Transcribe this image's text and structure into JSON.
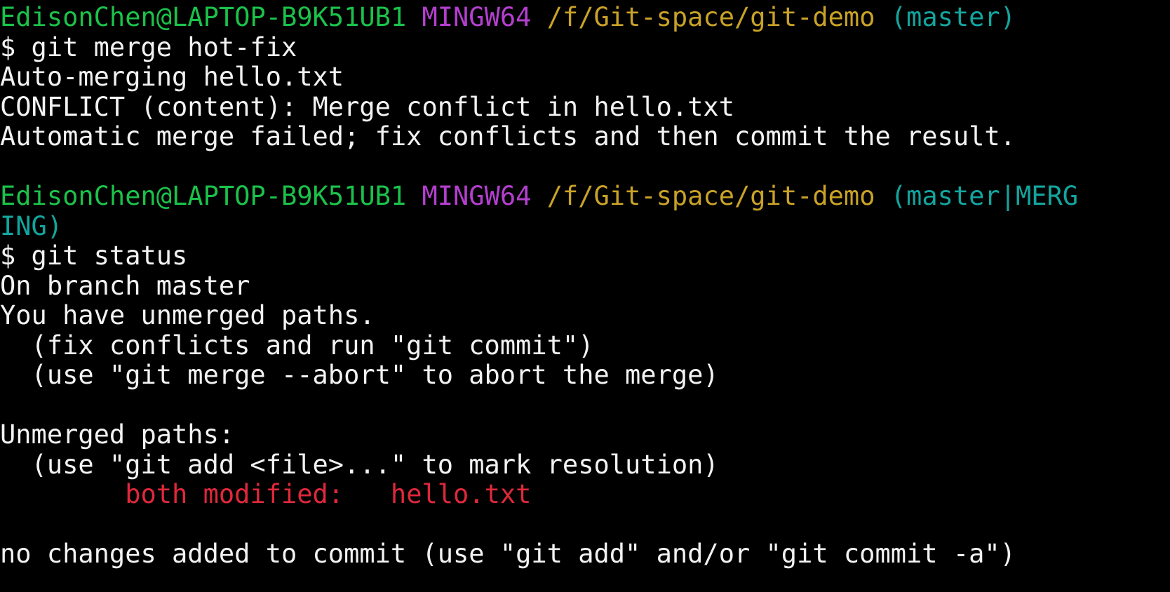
{
  "colors": {
    "background": "#000000",
    "foreground": "#f2f2f2",
    "user_host": "#1bc24a",
    "system": "#b43fcf",
    "path": "#c9a227",
    "branch": "#12a59e",
    "unmerged": "#e0283a"
  },
  "prompt1": {
    "user_host": "EdisonChen@LAPTOP-B9K51UB1",
    "system": "MINGW64",
    "path": "/f/Git-space/git-demo",
    "branch": "(master)"
  },
  "cmd1": "$ git merge hot-fix",
  "merge_output": [
    "Auto-merging hello.txt",
    "CONFLICT (content): Merge conflict in hello.txt",
    "Automatic merge failed; fix conflicts and then commit the result."
  ],
  "prompt2": {
    "user_host": "EdisonChen@LAPTOP-B9K51UB1",
    "system": "MINGW64",
    "path": "/f/Git-space/git-demo",
    "branch_part1": "(master|MERG",
    "branch_part2": "ING)"
  },
  "cmd2": "$ git status",
  "status_output": {
    "branch_line": "On branch master",
    "unmerged_notice": "You have unmerged paths.",
    "hint_commit": "  (fix conflicts and run \"git commit\")",
    "hint_abort": "  (use \"git merge --abort\" to abort the merge)",
    "unmerged_header": "Unmerged paths:",
    "hint_add": "  (use \"git add <file>...\" to mark resolution)",
    "file_status": "both modified:",
    "file_name": "hello.txt",
    "footer": "no changes added to commit (use \"git add\" and/or \"git commit -a\")"
  }
}
